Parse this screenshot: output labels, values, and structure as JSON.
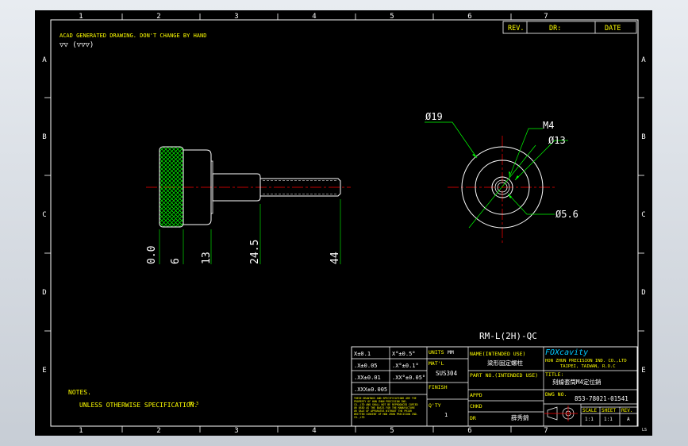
{
  "border": {
    "columns": [
      "1",
      "2",
      "3",
      "4",
      "5",
      "6",
      "7"
    ],
    "rows": [
      "A",
      "B",
      "C",
      "D",
      "E"
    ],
    "corner_mark": "LS"
  },
  "revision_block": {
    "rev": "REV.",
    "dr": "DR:",
    "date": "DATE"
  },
  "header_note": {
    "line1": "ACAD GENERATED DRAWING. DON'T CHANGE BY HAND",
    "line2": "▽▽ (▽▽▽)"
  },
  "side_dims": [
    "0.0",
    "6",
    "13",
    "24.5",
    "44"
  ],
  "circle_dims": {
    "d19": "Ø19",
    "m4": "M4",
    "d13": "Ø13",
    "d56": "Ø5.6"
  },
  "part_label": "RM-L(2H)-QC",
  "notes": {
    "title": "NOTES.",
    "line": "UNLESS OTHERWISE SPECIFICATION.",
    "suffix": "EB-3"
  },
  "title_block": {
    "tol_1": "X±0.1",
    "tol_2": ".X±0.05",
    "tol_3": ".XX±0.01",
    "tol_4": ".XXX±0.005",
    "ang_1": "X°±0.5°",
    "ang_2": ".X°±0.1°",
    "ang_3": ".XX°±0.05°",
    "units_label": "UNITS",
    "units_value": "MM",
    "matl_label": "MAT'L",
    "matl_value": "SUS304",
    "finish_label": "FINISH",
    "qty_label": "Q'TY",
    "qty_value": "1",
    "name_label": "NAME(INTENDED USE)",
    "name_value": "梁形固定螺柱",
    "part_no_label": "PART NO.(INTENDED USE)",
    "appd_label": "APPD",
    "chkd_label": "CHKD",
    "dr_label": "DR",
    "dr_value": "薛秀錦",
    "company_logo": "FOXcavity",
    "company_name": "HON ZHUN PRECISION IND. CO.,LTD",
    "company_city": "TAIPEI, TAIWAN, R.O.C",
    "title_label": "TITLE:",
    "title_value": "刻線套筒M4定位銷",
    "dwg_label": "DWG NO.",
    "dwg_value": "853-78021-01541",
    "scale_label": "SCALE",
    "sheet_label": "SHEET",
    "rev_label": "REV.",
    "scale_value": "1:1",
    "sheet_value": "1:1",
    "rev_value": "A",
    "disclaimer": "THESE DRAWINGS AND SPECIFICATIONS ARE THE PROPERTY OF HON ZHUN PRECISION IND. CO.,LTD AND SHALL NOT BE REPRODUCED COPIED OR USED AS THE BASIS FOR THE MANUFACTURE OR SALE OF APPARATUS WITHOUT THE PRIOR WRITTEN CONSENT OF HON ZHUN PRECISION IND. CO.,LTD"
  },
  "colors": {
    "line": "#ffffff",
    "dim": "#00ff00",
    "center": "#ff0000",
    "text_yellow": "#ffff00",
    "text_white": "#ffffff",
    "logo": "#00c8ff"
  }
}
